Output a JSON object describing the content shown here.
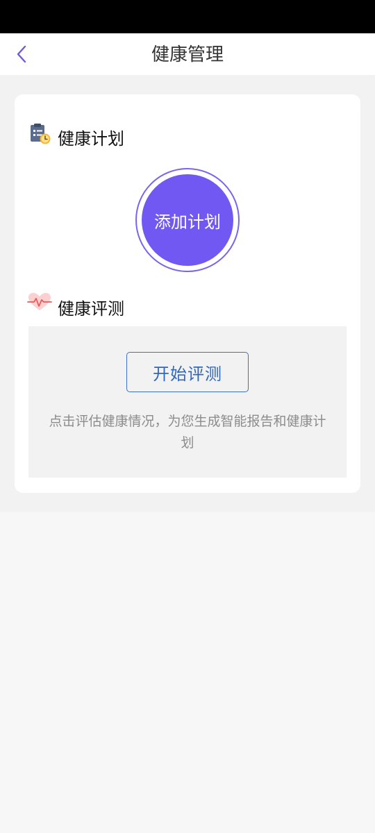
{
  "colors": {
    "accent_purple": "#7258f2",
    "accent_blue": "#2f67c0",
    "back_arrow": "#6b5bd6",
    "heart_pink": "#f07a7a"
  },
  "header": {
    "title": "健康管理",
    "back_icon": "chevron-left-icon"
  },
  "plan_section": {
    "icon": "clipboard-clock-icon",
    "title": "健康计划",
    "add_button_label": "添加计划"
  },
  "evaluation_section": {
    "icon": "heartbeat-icon",
    "title": "健康评测",
    "start_button_label": "开始评测",
    "hint": "点击评估健康情况，为您生成智能报告和健康计划"
  }
}
